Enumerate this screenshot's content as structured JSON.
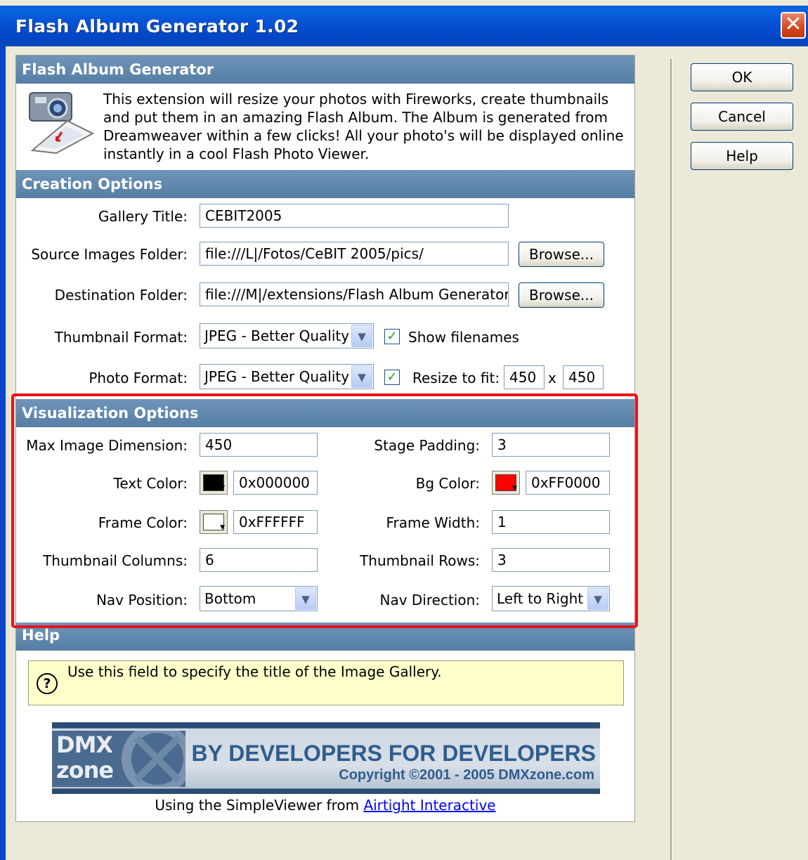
{
  "window": {
    "title": "Flash Album Generator 1.02"
  },
  "buttons": {
    "ok": "OK",
    "cancel": "Cancel",
    "help": "Help"
  },
  "header": {
    "title": "Flash Album Generator",
    "description": "This extension will resize your photos with Fireworks, create thumbnails and put them in an amazing Flash Album. The Album is generated from Dreamweaver within a few clicks! All your photo's will be displayed online instantly in a cool Flash Photo Viewer."
  },
  "creation": {
    "section_title": "Creation Options",
    "gallery_title_label": "Gallery Title:",
    "gallery_title_value": "CEBIT2005",
    "source_label": "Source Images Folder:",
    "source_value": "file:///L|/Fotos/CeBIT 2005/pics/",
    "dest_label": "Destination Folder:",
    "dest_value": "file:///M|/extensions/Flash Album Generator",
    "browse_label": "Browse...",
    "thumb_format_label": "Thumbnail Format:",
    "thumb_format_value": "JPEG - Better Quality",
    "show_filenames_label": "Show filenames",
    "show_filenames_checked": true,
    "photo_format_label": "Photo Format:",
    "photo_format_value": "JPEG - Better Quality",
    "resize_label": "Resize to fit:",
    "resize_checked": true,
    "resize_width": "450",
    "resize_x": "x",
    "resize_height": "450"
  },
  "visualization": {
    "section_title": "Visualization Options",
    "max_dim_label": "Max Image Dimension:",
    "max_dim_value": "450",
    "stage_padding_label": "Stage Padding:",
    "stage_padding_value": "3",
    "text_color_label": "Text Color:",
    "text_color_value": "0x000000",
    "text_color_swatch": "#000000",
    "bg_color_label": "Bg Color:",
    "bg_color_value": "0xFF0000",
    "bg_color_swatch": "#ff0000",
    "frame_color_label": "Frame Color:",
    "frame_color_value": "0xFFFFFF",
    "frame_color_swatch": "#ffffff",
    "frame_width_label": "Frame Width:",
    "frame_width_value": "1",
    "thumb_cols_label": "Thumbnail Columns:",
    "thumb_cols_value": "6",
    "thumb_rows_label": "Thumbnail Rows:",
    "thumb_rows_value": "3",
    "nav_position_label": "Nav Position:",
    "nav_position_value": "Bottom",
    "nav_direction_label": "Nav Direction:",
    "nav_direction_value": "Left to Right"
  },
  "help": {
    "section_title": "Help",
    "text": "Use this field to specify the title of the Image Gallery."
  },
  "banner": {
    "logo_top": "DMX",
    "logo_bottom": "zone",
    "slogan": "BY DEVELOPERS FOR DEVELOPERS",
    "copyright": "Copyright ©2001 - 2005 DMXzone.com"
  },
  "footer": {
    "prefix": "Using the SimpleViewer from ",
    "link": "Airtight Interactive"
  },
  "highlight_color": "#e8141c"
}
